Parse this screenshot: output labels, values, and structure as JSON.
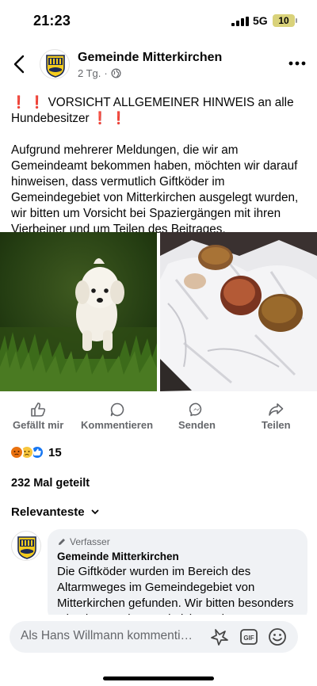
{
  "status_bar": {
    "time": "21:23",
    "network": "5G",
    "battery": "10"
  },
  "post": {
    "page_name": "Gemeinde Mitterkirchen",
    "age": "2 Tg.",
    "separator": "·",
    "headline_emoji": "❗",
    "headline": "VORSICHT ALLGEMEINER HINWEIS an alle Hundebesitzer",
    "body": "Aufgrund mehrerer Meldungen, die wir am Gemeindeamt bekommen haben, möchten wir darauf hinweisen, dass vermutlich Giftköder im Gemeindegebiet von Mitterkirchen ausgelegt wurden, wir bitten um Vorsicht bei Spaziergängen mit ihren Vierbeiner und um Teilen des Beitrages."
  },
  "actions": {
    "like": "Gefällt mir",
    "comment": "Kommentieren",
    "send": "Senden",
    "share": "Teilen"
  },
  "reactions": {
    "count": "15",
    "types": [
      "angry-icon",
      "sad-icon",
      "like-icon"
    ]
  },
  "shares": "232 Mal geteilt",
  "sort_label": "Relevanteste",
  "comment": {
    "badge": "Verfasser",
    "author": "Gemeinde Mitterkirchen",
    "text": "Die Giftköder wurden im Bereich des Altarmweges im Gemeindegebiet von Mitterkirchen gefunden. Wir bitten besonders Obacht zu geben und nicht auch"
  },
  "composer": {
    "placeholder": "Als Hans Willmann kommenti…"
  },
  "colors": {
    "accent": "#1877f2",
    "secondary_text": "#65676b",
    "bubble": "#f0f2f5",
    "alert": "#e02020"
  }
}
